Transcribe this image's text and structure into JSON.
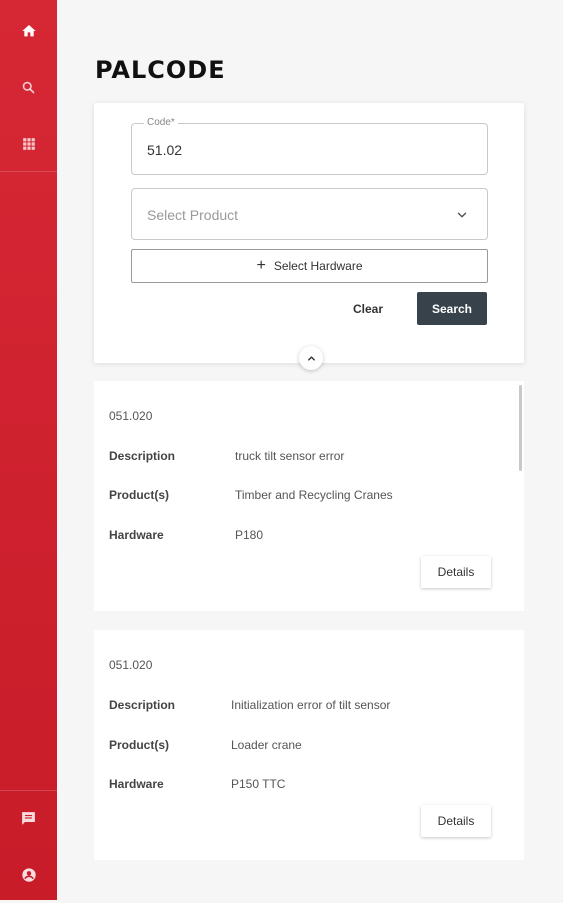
{
  "page": {
    "title": "PALCODE"
  },
  "colors": {
    "sidebar": "#d62735",
    "search_button": "#37424a"
  },
  "sidebar": {
    "top_items": [
      {
        "icon": "home-icon"
      },
      {
        "icon": "search-icon"
      },
      {
        "icon": "grid-icon"
      }
    ],
    "bottom_items": [
      {
        "icon": "chat-icon"
      },
      {
        "icon": "account-icon"
      }
    ]
  },
  "search": {
    "code_label": "Code*",
    "code_value": "51.02",
    "product_placeholder": "Select Product",
    "hardware_button": "Select Hardware",
    "clear_label": "Clear",
    "search_label": "Search"
  },
  "results": [
    {
      "code": "051.020",
      "description_label": "Description",
      "description": "truck tilt sensor error",
      "products_label": "Product(s)",
      "products": "Timber and Recycling Cranes",
      "hardware_label": "Hardware",
      "hardware": "P180",
      "details_label": "Details"
    },
    {
      "code": "051.020",
      "description_label": "Description",
      "description": "Initialization error of tilt sensor",
      "products_label": "Product(s)",
      "products": "Loader crane",
      "hardware_label": "Hardware",
      "hardware": "P150 TTC",
      "details_label": "Details"
    }
  ]
}
